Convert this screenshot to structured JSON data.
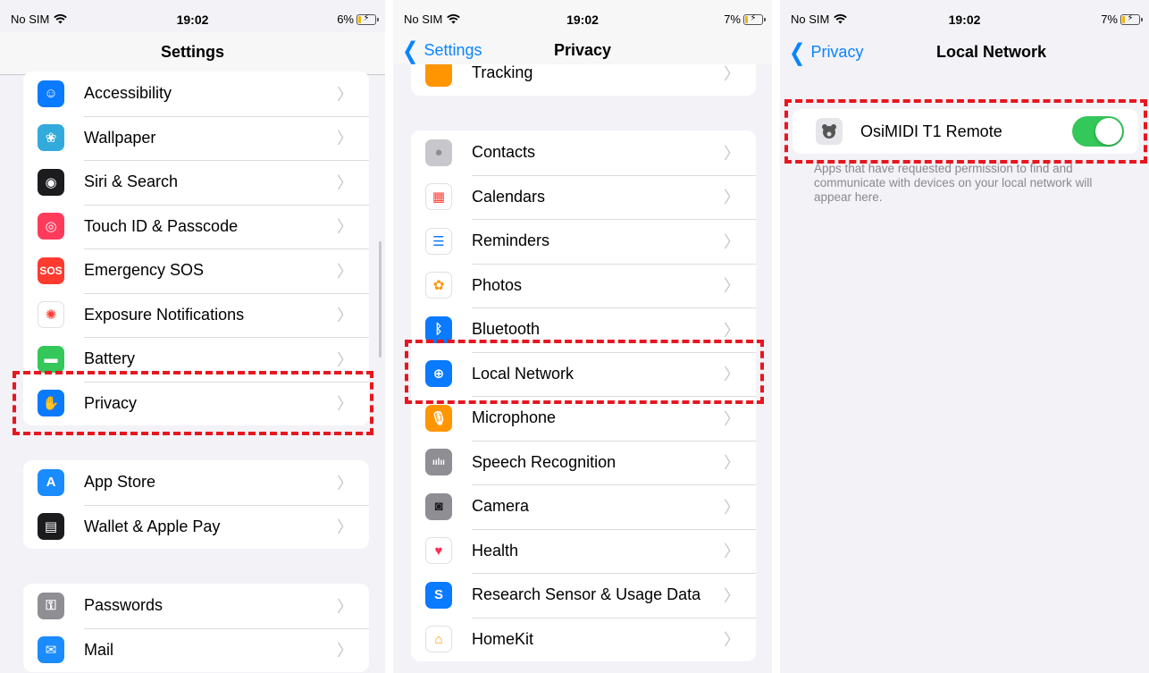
{
  "status_bars": [
    {
      "carrier": "No SIM",
      "time": "19:02",
      "battery": "6%"
    },
    {
      "carrier": "No SIM",
      "time": "19:02",
      "battery": "7%"
    },
    {
      "carrier": "No SIM",
      "time": "19:02",
      "battery": "7%"
    }
  ],
  "settings": {
    "title": "Settings",
    "group1": [
      {
        "label": "Accessibility",
        "icon": "accessibility-icon",
        "color": "#0a7aff"
      },
      {
        "label": "Wallpaper",
        "icon": "wallpaper-icon",
        "color": "#33aadc"
      },
      {
        "label": "Siri & Search",
        "icon": "siri-icon",
        "color": "#1c1c1e"
      },
      {
        "label": "Touch ID & Passcode",
        "icon": "fingerprint-icon",
        "color": "#ff3b5c"
      },
      {
        "label": "Emergency SOS",
        "icon": "sos-icon",
        "color": "#ff3b30",
        "icon_text": "SOS"
      },
      {
        "label": "Exposure Notifications",
        "icon": "exposure-icon",
        "color": "#ffffff"
      },
      {
        "label": "Battery",
        "icon": "battery-icon",
        "color": "#34c759"
      },
      {
        "label": "Privacy",
        "icon": "hand-icon",
        "color": "#0a7aff"
      }
    ],
    "group2": [
      {
        "label": "App Store",
        "icon": "app-store-icon",
        "color": "#1a8cff"
      },
      {
        "label": "Wallet & Apple Pay",
        "icon": "wallet-icon",
        "color": "#1c1c1e"
      }
    ],
    "group3": [
      {
        "label": "Passwords",
        "icon": "key-icon",
        "color": "#8e8e93"
      },
      {
        "label": "Mail",
        "icon": "mail-icon",
        "color": "#1a8cff"
      }
    ]
  },
  "privacy": {
    "title": "Privacy",
    "back_label": "Settings",
    "partial_row": "Tracking",
    "items": [
      {
        "label": "Contacts",
        "icon": "contacts-icon",
        "color": "#c7c7cc"
      },
      {
        "label": "Calendars",
        "icon": "calendar-icon",
        "color": "#ffffff"
      },
      {
        "label": "Reminders",
        "icon": "reminders-icon",
        "color": "#ffffff"
      },
      {
        "label": "Photos",
        "icon": "photos-icon",
        "color": "#ffffff"
      },
      {
        "label": "Bluetooth",
        "icon": "bluetooth-icon",
        "color": "#0a7aff"
      },
      {
        "label": "Local Network",
        "icon": "globe-icon",
        "color": "#0a7aff"
      },
      {
        "label": "Microphone",
        "icon": "microphone-icon",
        "color": "#ff9500"
      },
      {
        "label": "Speech Recognition",
        "icon": "waveform-icon",
        "color": "#8e8e93"
      },
      {
        "label": "Camera",
        "icon": "camera-icon",
        "color": "#8e8e93"
      },
      {
        "label": "Health",
        "icon": "heart-icon",
        "color": "#ffffff"
      },
      {
        "label": "Research Sensor & Usage Data",
        "icon": "research-icon",
        "color": "#0a7aff"
      },
      {
        "label": "HomeKit",
        "icon": "home-icon",
        "color": "#ffffff"
      }
    ]
  },
  "local_network": {
    "title": "Local Network",
    "back_label": "Privacy",
    "app_name": "OsiMIDI T1 Remote",
    "toggle_on": true,
    "footer": "Apps that have requested permission to find and communicate with devices on your local network will appear here."
  }
}
